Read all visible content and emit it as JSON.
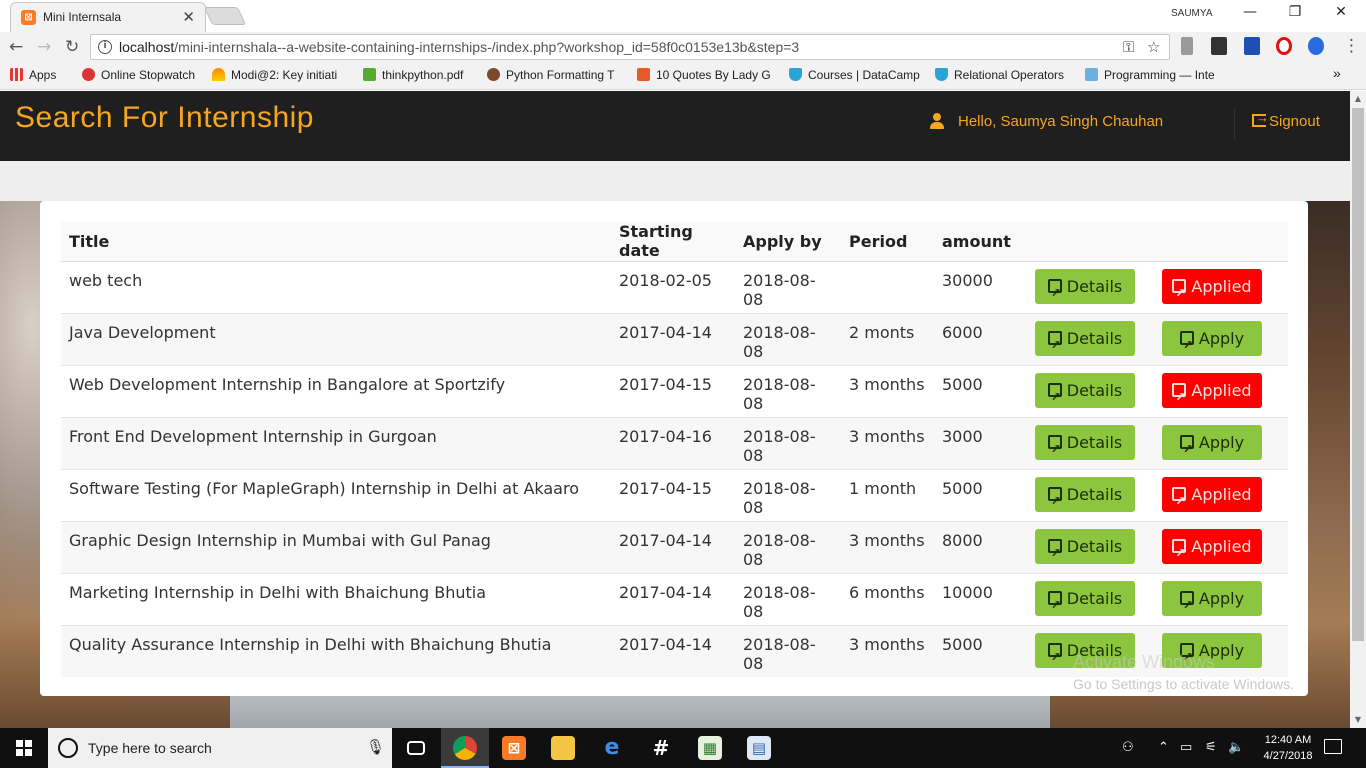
{
  "browser": {
    "tab_title": "Mini Internsala",
    "user": "SAUMYA",
    "url_host": "localhost",
    "url_path": "/mini-internshala--a-website-containing-internships-/index.php?workshop_id=58f0c0153e13b&step=3",
    "bookmarks": [
      "Apps",
      "Online Stopwatch",
      "Modi@2: Key initiati",
      "thinkpython.pdf",
      "Python Formatting T",
      "10 Quotes By Lady G",
      "Courses | DataCamp",
      "Relational Operators",
      "Programming — Inte"
    ]
  },
  "navbar": {
    "brand": "Search For Internship",
    "hello": "Hello,  Saumya Singh Chauhan",
    "signout": "Signout"
  },
  "table": {
    "headers": [
      "Title",
      "Starting date",
      "Apply by",
      "Period",
      "amount"
    ],
    "details_label": "Details",
    "rows": [
      {
        "title": "web tech",
        "start": "2018-02-05",
        "apply_by": "2018-08-08",
        "period": "",
        "amount": "30000",
        "action": "Applied"
      },
      {
        "title": "Java Development",
        "start": "2017-04-14",
        "apply_by": "2018-08-08",
        "period": "2 monts",
        "amount": "6000",
        "action": "Apply"
      },
      {
        "title": "Web Development Internship in Bangalore at Sportzify",
        "start": "2017-04-15",
        "apply_by": "2018-08-08",
        "period": "3 months",
        "amount": "5000",
        "action": "Applied"
      },
      {
        "title": "Front End Development Internship in Gurgoan",
        "start": "2017-04-16",
        "apply_by": "2018-08-08",
        "period": "3 months",
        "amount": "3000",
        "action": "Apply"
      },
      {
        "title": "Software Testing (For MapleGraph) Internship in Delhi at Akaaro",
        "start": "2017-04-15",
        "apply_by": "2018-08-08",
        "period": "1 month",
        "amount": "5000",
        "action": "Applied"
      },
      {
        "title": "Graphic Design Internship in Mumbai with Gul Panag",
        "start": "2017-04-14",
        "apply_by": "2018-08-08",
        "period": "3 months",
        "amount": "8000",
        "action": "Applied"
      },
      {
        "title": "Marketing Internship in Delhi with Bhaichung Bhutia",
        "start": "2017-04-14",
        "apply_by": "2018-08-08",
        "period": "6 months",
        "amount": "10000",
        "action": "Apply"
      },
      {
        "title": "Quality Assurance Internship in Delhi with Bhaichung Bhutia",
        "start": "2017-04-14",
        "apply_by": "2018-08-08",
        "period": "3 months",
        "amount": "5000",
        "action": "Apply"
      }
    ]
  },
  "watermark": {
    "title": "Activate Windows",
    "text": "Go to Settings to activate Windows."
  },
  "taskbar": {
    "search_placeholder": "Type here to search",
    "time": "12:40 AM",
    "date": "4/27/2018"
  },
  "colors": {
    "brand": "#f5a623",
    "navbar_bg": "#1f1f1f",
    "btn_green": "#8cc63f",
    "btn_red": "#ff0000"
  }
}
